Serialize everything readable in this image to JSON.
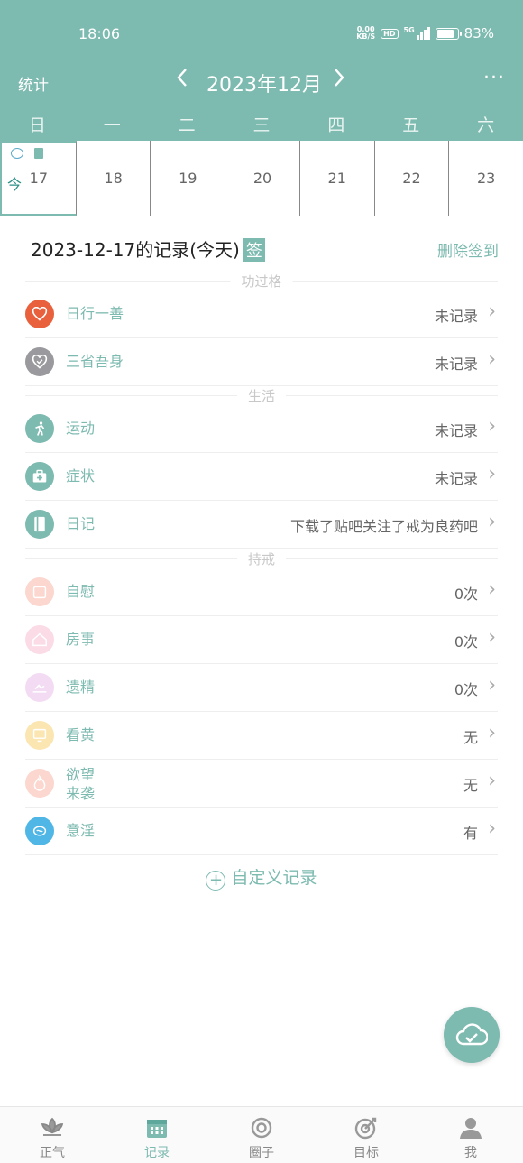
{
  "status": {
    "time": "18:06",
    "net_speed_value": "0.00",
    "net_speed_unit": "KB/S",
    "hd": "HD",
    "signal": "5G",
    "battery": "83%",
    "battery_level": 0.83
  },
  "header": {
    "stats": "统计",
    "month": "2023年12月",
    "more": "···"
  },
  "weekdays": [
    "日",
    "一",
    "二",
    "三",
    "四",
    "五",
    "六"
  ],
  "week": [
    {
      "day": "17",
      "today_mark": "今"
    },
    {
      "day": "18"
    },
    {
      "day": "19"
    },
    {
      "day": "20"
    },
    {
      "day": "21"
    },
    {
      "day": "22"
    },
    {
      "day": "23"
    }
  ],
  "record": {
    "title": "2023-12-17的记录(今天)",
    "sign_badge": "签",
    "delete_sign": "删除签到"
  },
  "sections": {
    "merit": "功过格",
    "life": "生活",
    "abstain": "持戒"
  },
  "rows": [
    {
      "label": "日行一善",
      "value": "未记录",
      "color": "#e8603c"
    },
    {
      "label": "三省吾身",
      "value": "未记录",
      "color": "#9a9a9e"
    },
    {
      "label": "运动",
      "value": "未记录",
      "color": "#7dbab0"
    },
    {
      "label": "症状",
      "value": "未记录",
      "color": "#7dbab0"
    },
    {
      "label": "日记",
      "value": "下载了贴吧关注了戒为良药吧",
      "color": "#7dbab0"
    },
    {
      "label": "自慰",
      "value": "0次",
      "color": "#fbd7cf"
    },
    {
      "label": "房事",
      "value": "0次",
      "color": "#fbdbe6"
    },
    {
      "label": "遗精",
      "value": "0次",
      "color": "#f3dcf3"
    },
    {
      "label": "看黄",
      "value": "无",
      "color": "#fbe6b2"
    },
    {
      "label": "欲望\n来袭",
      "value": "无",
      "color": "#fbd7cf"
    },
    {
      "label": "意淫",
      "value": "有",
      "color": "#4fb6e6"
    }
  ],
  "custom_record": "自定义记录",
  "nav": [
    "正气",
    "记录",
    "圈子",
    "目标",
    "我"
  ]
}
